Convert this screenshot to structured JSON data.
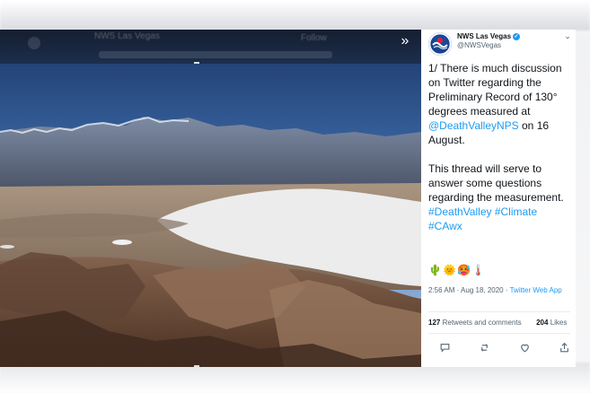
{
  "media": {
    "ghost_name": "NWS Las Vegas",
    "ghost_follow": "Follow",
    "expand_icon": "double-chevron-right-icon",
    "background_alt": "mountain-valley-photo"
  },
  "tweet": {
    "account": {
      "name": "NWS Las Vegas",
      "handle": "@NWSVegas",
      "verified_icon": "verified-badge-icon",
      "more_icon": "chevron-down-icon"
    },
    "body": {
      "p1_before": "1/  There is much discussion on Twitter regarding the Preliminary Record of 130° degrees measured at ",
      "mention": "@DeathValleyNPS",
      "p1_after": " on 16 August.",
      "p2": "This thread will serve to answer some questions regarding the measurement.",
      "hashtag1": "#DeathValley",
      "hashtag2": "#Climate",
      "hashtag3": "#CAwx"
    },
    "emojis": [
      "🌵",
      "🌞",
      "🥵",
      "🌡️"
    ],
    "meta": {
      "time": "2:56 AM",
      "dot": " · ",
      "date": "Aug 18, 2020",
      "app": "Twitter Web App"
    },
    "stats": {
      "retweets_count": "127",
      "retweets_label": "Retweets and comments",
      "likes_count": "204",
      "likes_label": "Likes"
    },
    "actions": {
      "reply_icon": "reply-icon",
      "retweet_icon": "retweet-icon",
      "like_icon": "heart-icon",
      "share_icon": "share-icon"
    }
  },
  "colors": {
    "link": "#1d9bf0",
    "text": "#0f1419",
    "muted": "#536471"
  }
}
